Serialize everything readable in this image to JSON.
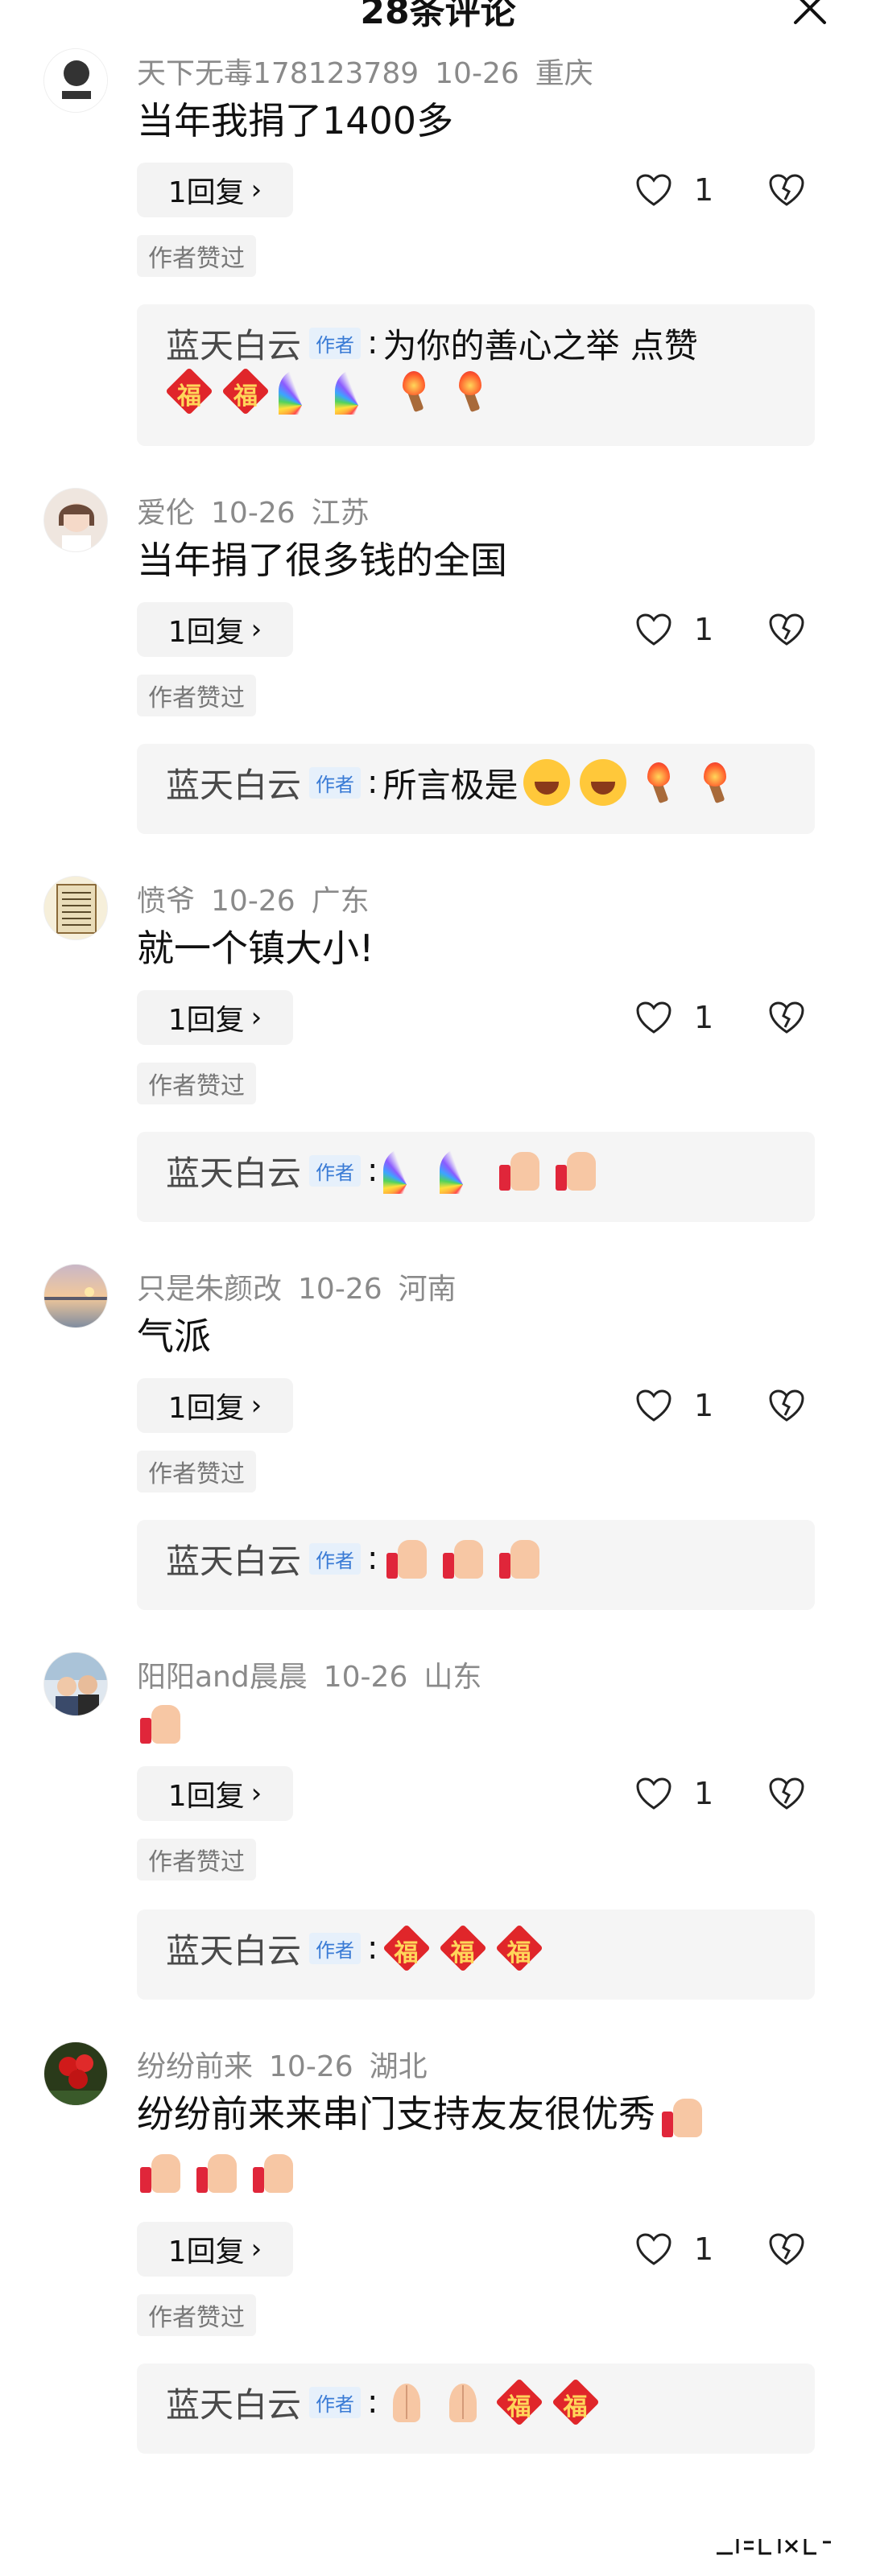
{
  "header": {
    "title": "28条评论"
  },
  "comments": [
    {
      "user": "天下无毒178123789",
      "date": "10-26",
      "location": "重庆",
      "text": "当年我捐了1400多",
      "reply_count": "1回复",
      "likes": "1",
      "author_liked": "作者赞过",
      "reply": {
        "name": "蓝天白云",
        "tag": "作者",
        "text": "为你的善心之举 点赞",
        "emoji": [
          "fu",
          "fu",
          "rainbow",
          "rainbow",
          "torch",
          "torch"
        ]
      }
    },
    {
      "user": "爱伦",
      "date": "10-26",
      "location": "江苏",
      "text": "当年捐了很多钱的全国",
      "reply_count": "1回复",
      "likes": "1",
      "author_liked": "作者赞过",
      "reply": {
        "name": "蓝天白云",
        "tag": "作者",
        "text": "所言极是",
        "emoji": [
          "laugh",
          "laugh",
          "torch",
          "torch"
        ]
      }
    },
    {
      "user": "愤爷",
      "date": "10-26",
      "location": "广东",
      "text": "就一个镇大小!",
      "reply_count": "1回复",
      "likes": "1",
      "author_liked": "作者赞过",
      "reply": {
        "name": "蓝天白云",
        "tag": "作者",
        "text": "",
        "emoji": [
          "rainbow",
          "rainbow",
          "thumb",
          "thumb"
        ]
      }
    },
    {
      "user": "只是朱颜改",
      "date": "10-26",
      "location": "河南",
      "text": "气派",
      "reply_count": "1回复",
      "likes": "1",
      "author_liked": "作者赞过",
      "reply": {
        "name": "蓝天白云",
        "tag": "作者",
        "text": "",
        "emoji": [
          "thumb",
          "thumb",
          "thumb"
        ]
      }
    },
    {
      "user": "阳阳and晨晨",
      "date": "10-26",
      "location": "山东",
      "text": "",
      "reply_count": "1回复",
      "likes": "1",
      "author_liked": "作者赞过",
      "reply": {
        "name": "蓝天白云",
        "tag": "作者",
        "text": "",
        "emoji": [
          "fu",
          "fu",
          "fu"
        ]
      }
    },
    {
      "user": "纷纷前来",
      "date": "10-26",
      "location": "湖北",
      "text": "纷纷前来来串门支持友友很优秀",
      "reply_count": "1回复",
      "likes": "1",
      "author_liked": "作者赞过",
      "reply": {
        "name": "蓝天白云",
        "tag": "作者",
        "text": "",
        "emoji": [
          "pray",
          "pray",
          "fu",
          "fu"
        ]
      }
    }
  ],
  "colors": {
    "author_tag_bg": "#e6f0fb",
    "author_tag_text": "#3a7bd5",
    "meta": "#8a8a8a",
    "fu_red": "#e0262a"
  }
}
